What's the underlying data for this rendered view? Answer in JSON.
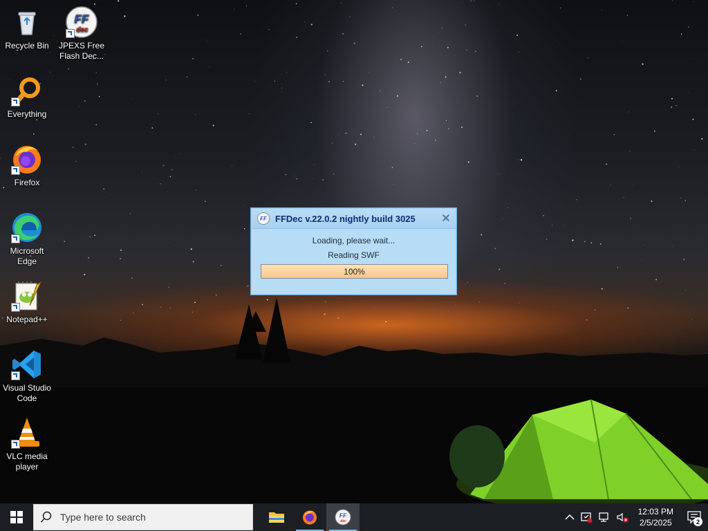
{
  "desktop": {
    "icons": [
      {
        "label": "Recycle Bin",
        "icon": "recycle-bin-icon"
      },
      {
        "label": "JPEXS Free Flash Dec...",
        "icon": "ffdec-icon"
      },
      {
        "label": "Everything",
        "icon": "everything-search-icon"
      },
      {
        "label": "Firefox",
        "icon": "firefox-icon"
      },
      {
        "label": "Microsoft Edge",
        "icon": "edge-icon"
      },
      {
        "label": "Notepad++",
        "icon": "notepadpp-icon"
      },
      {
        "label": "Visual Studio Code",
        "icon": "vscode-icon"
      },
      {
        "label": "VLC media player",
        "icon": "vlc-icon"
      }
    ]
  },
  "dialog": {
    "title": "FFDec v.22.0.2 nightly build 3025",
    "app_icon_text": "FF",
    "close_glyph": "✕",
    "message": "Loading, please wait...",
    "status": "Reading SWF",
    "progress_label": "100%",
    "progress_value": 1.0
  },
  "taskbar": {
    "search_placeholder": "Type here to search",
    "apps": [
      {
        "name": "File Explorer",
        "icon": "folder-icon"
      },
      {
        "name": "Firefox",
        "icon": "firefox-icon"
      },
      {
        "name": "FFDec",
        "icon": "ffdec-icon"
      }
    ],
    "tray": {
      "time": "12:03 PM",
      "date": "2/5/2025",
      "notification_count": "2"
    }
  },
  "colors": {
    "dialog_bg": "#b7dcf5",
    "progress_fill": "#f7c98a",
    "taskbar_bg": "#1c1f24",
    "accent": "#76b9ed"
  }
}
